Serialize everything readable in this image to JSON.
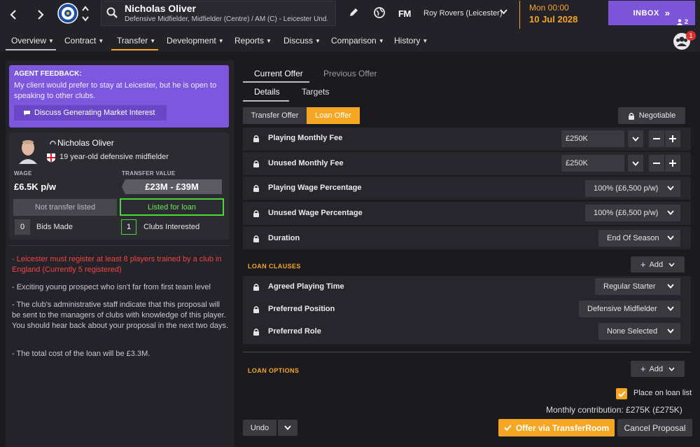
{
  "header": {
    "player_name": "Nicholas Oliver",
    "player_positions": "Defensive Midfielder, Midfielder (Centre) / AM (C) - Leicester Und...",
    "fm_logo": "FM",
    "manager": "Roy Rovers (Leicester)",
    "date_day": "Mon 00:00",
    "date_full": "10 Jul 2028",
    "inbox_label": "INBOX",
    "people_count": "2",
    "notification_count": "1"
  },
  "nav": {
    "items": [
      "Overview",
      "Contract",
      "Transfer",
      "Development",
      "Reports",
      "Discuss",
      "Comparison",
      "History"
    ],
    "active": [
      "Overview",
      "Transfer"
    ]
  },
  "agent": {
    "title": "AGENT FEEDBACK:",
    "message": "My client would prefer to stay at Leicester, but he is open to speaking to other clubs.",
    "discuss_button": "Discuss Generating Market Interest"
  },
  "player_card": {
    "name": "Nicholas Oliver",
    "description": "19 year-old defensive midfielder",
    "wage_label": "WAGE",
    "wage_value": "£6.5K p/w",
    "transfer_value_label": "TRANSFER VALUE",
    "transfer_value": "£23M - £39M",
    "not_transfer_listed": "Not transfer listed",
    "listed_for_loan": "Listed for loan",
    "bids_count": "0",
    "bids_label": "Bids Made",
    "clubs_count": "1",
    "clubs_label": "Clubs Interested"
  },
  "notes": {
    "warning": "- Leicester must register at least 8 players trained by a club in England (Currently 5 registered)",
    "n1": "- Exciting young prospect who isn't far from first team level",
    "n2": "- The club's administrative staff indicate that this proposal will be sent to the managers of clubs with knowledge of this player. You should hear back about your proposal in the next two days.",
    "n3": "- The total cost of the loan will be £3.3M."
  },
  "offer": {
    "tab_current": "Current Offer",
    "tab_previous": "Previous Offer",
    "tab_details": "Details",
    "tab_targets": "Targets",
    "toggle_transfer": "Transfer Offer",
    "toggle_loan": "Loan Offer",
    "negotiable": "Negotiable",
    "rows": {
      "playing_fee_label": "Playing Monthly Fee",
      "playing_fee_value": "£250K",
      "unused_fee_label": "Unused Monthly Fee",
      "unused_fee_value": "£250K",
      "playing_wage_label": "Playing Wage Percentage",
      "playing_wage_value": "100% (£6,500 p/w)",
      "unused_wage_label": "Unused Wage Percentage",
      "unused_wage_value": "100% (£6,500 p/w)",
      "duration_label": "Duration",
      "duration_value": "End Of Season"
    },
    "clauses_title": "LOAN CLAUSES",
    "add_label": "Add",
    "clauses": {
      "playing_time_label": "Agreed Playing Time",
      "playing_time_value": "Regular Starter",
      "position_label": "Preferred Position",
      "position_value": "Defensive Midfielder",
      "role_label": "Preferred Role",
      "role_value": "None Selected"
    },
    "options_title": "LOAN OPTIONS",
    "place_on_loan_list": "Place on loan list",
    "monthly_contribution": "Monthly contribution: £275K (£275K)",
    "undo": "Undo",
    "offer_button": "Offer via TransferRoom",
    "cancel_button": "Cancel Proposal"
  },
  "colors": {
    "accent": "#f5a623",
    "agent_purple": "#7d58df",
    "positive_green": "#4cd637",
    "warning_red": "#f04545"
  }
}
